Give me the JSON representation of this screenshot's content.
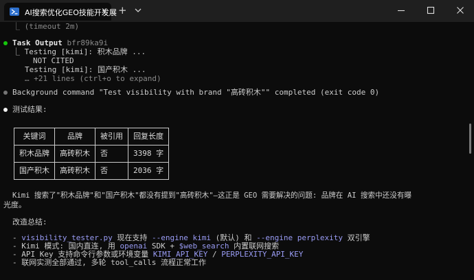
{
  "tab": {
    "title": "AI搜索优化GEO技能开发展",
    "close": "✕",
    "new_tab": "+"
  },
  "colors": {
    "background": "#0c0c0c",
    "titlebar": "#1f1f1f",
    "green_dot": "#16c60c",
    "gray_dot": "#767676",
    "white_dot": "#f2f2f2",
    "code_purple": "#9a9cf5"
  },
  "icons": {
    "tab_icon": "powershell-icon",
    "dropdown": "chevron-down-icon",
    "minimize": "minimize-icon",
    "maximize": "maximize-icon",
    "close": "close-icon"
  },
  "terminal": {
    "timeout_line": "⎿ (timeout 2m)",
    "task_output_label": "Task Output",
    "task_output_id": "bfr89ka9i",
    "testing1": "⎿ Testing [kimi]: 积木品牌 ...",
    "not_cited": "NOT CITED",
    "testing2": "Testing [kimi]: 国产积木 ...",
    "more_lines": "… +21 lines (ctrl+o to expand)",
    "background_cmd": "Background command \"Test visibility with brand \"高砖积木\"\" completed (exit code 0)",
    "results_title": "测试结果:",
    "table": {
      "headers": [
        "关键词",
        "品牌",
        "被引用",
        "回复长度"
      ],
      "rows": [
        [
          "积木品牌",
          "高砖积木",
          "否",
          "3398 字"
        ],
        [
          "国产积木",
          "高砖积木",
          "否",
          "2036 字"
        ]
      ]
    },
    "summary_line1": "Kimi 搜索了\"积木品牌\"和\"国产积木\"都没有提到\"高砖积木\"—这正是 GEO 需要解决的问题: 品牌在 AI 搜索中还没有曝",
    "summary_line2": "光度。",
    "improvements_title": "改造总结:",
    "items": {
      "i1_code": "visibility_tester.py",
      "i1_text1": " 现在支持 ",
      "i1_code2": "--engine kimi",
      "i1_text2": " (默认) 和 ",
      "i1_code3": "--engine perplexity",
      "i1_text3": " 双引擎",
      "i2_text1": "Kimi 模式: 国内直连, 用 ",
      "i2_code1": "openai",
      "i2_text2": " SDK + ",
      "i2_code2": "$web_search",
      "i2_text3": " 内置联网搜索",
      "i3_text1": "API Key 支持命令行参数或环境变量 ",
      "i3_code1": "KIMI_API_KEY",
      "i3_text2": " / ",
      "i3_code2": "PERPLEXITY_API_KEY",
      "i4_text": "联网实测全部通过, 多轮 tool_calls 流程正常工作"
    }
  }
}
